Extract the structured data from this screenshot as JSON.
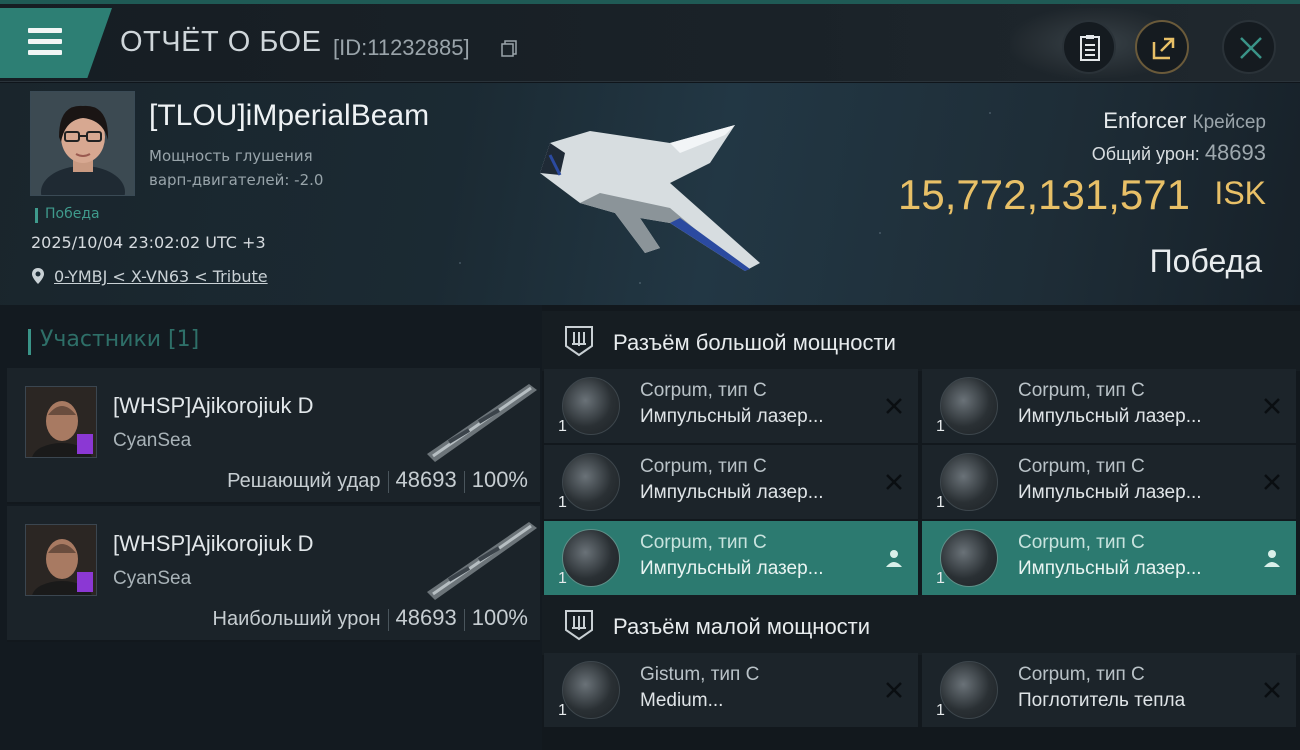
{
  "header": {
    "title": "ОТЧЁТ О БОЕ",
    "report_id": "[ID:11232885]"
  },
  "victim": {
    "pilot_name": "[TLOU]iMperialBeam",
    "stat_line1": "Мощность глушения",
    "stat_line2": "варп-двигателей: -2.0",
    "status_small": "Победа",
    "datetime": "2025/10/04 23:02:02 UTC +3",
    "location": "0-YMBJ < X-VN63 < Tribute",
    "ship_name": "Enforcer",
    "ship_class": "Крейсер",
    "damage_label": "Общий урон:",
    "damage_value": "48693",
    "isk_value": "15,772,131,571",
    "isk_unit": "ISK",
    "result": "Победа"
  },
  "participants": {
    "title": "Участники [1]",
    "rows": [
      {
        "name": "[WHSP]Ajikorojiuk D",
        "corp": "CyanSea",
        "role": "Решающий удар",
        "damage": "48693",
        "percent": "100%"
      },
      {
        "name": "[WHSP]Ajikorojiuk D",
        "corp": "CyanSea",
        "role": "Наибольший урон",
        "damage": "48693",
        "percent": "100%"
      }
    ]
  },
  "fitting": {
    "high_slots": {
      "title": "Разъём большой мощности",
      "modules": [
        {
          "name": "Corpum, тип C",
          "type": "Импульсный лазер...",
          "qty": "1",
          "status": "destroyed"
        },
        {
          "name": "Corpum, тип C",
          "type": "Импульсный лазер...",
          "qty": "1",
          "status": "destroyed"
        },
        {
          "name": "Corpum, тип C",
          "type": "Импульсный лазер...",
          "qty": "1",
          "status": "destroyed"
        },
        {
          "name": "Corpum, тип C",
          "type": "Импульсный лазер...",
          "qty": "1",
          "status": "destroyed"
        },
        {
          "name": "Corpum, тип C",
          "type": "Импульсный лазер...",
          "qty": "1",
          "status": "dropped"
        },
        {
          "name": "Corpum, тип C",
          "type": "Импульсный лазер...",
          "qty": "1",
          "status": "dropped"
        }
      ]
    },
    "low_slots": {
      "title": "Разъём малой мощности",
      "modules": [
        {
          "name": "Gistum, тип C",
          "type": "Medium...",
          "qty": "1",
          "status": "destroyed"
        },
        {
          "name": "Corpum, тип C",
          "type": "Поглотитель тепла",
          "qty": "1",
          "status": "destroyed"
        }
      ]
    }
  },
  "colors": {
    "accent": "#2d7f74",
    "isk_gold": "#e8c067",
    "victory_green": "#3f9a8c",
    "active_row": "#2c7a70"
  }
}
